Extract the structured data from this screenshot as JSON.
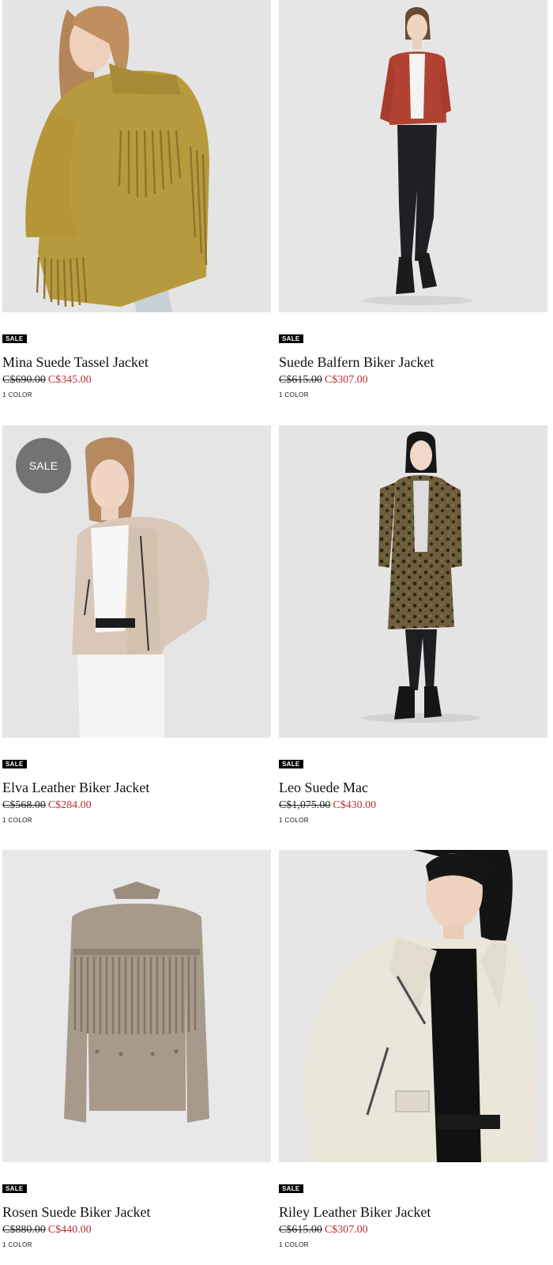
{
  "labels": {
    "sale_tag": "SALE",
    "sale_circle": "SALE"
  },
  "colors": {
    "sale_price": "#b4322c",
    "sale_tag_bg": "#000000",
    "sale_circle_bg": "#737373",
    "image_bg": "#e7e7e7"
  },
  "products": [
    {
      "name": "Mina Suede Tassel Jacket",
      "original_price": "C$690.00",
      "sale_price": "C$345.00",
      "colors": "1 COLOR",
      "image_subject": "model in mustard suede fringe jacket, rear view"
    },
    {
      "name": "Suede Balfern Biker Jacket",
      "original_price": "C$615.00",
      "sale_price": "C$307.00",
      "colors": "1 COLOR",
      "image_subject": "model in rust suede biker jacket, full length"
    },
    {
      "name": "Elva Leather Biker Jacket",
      "original_price": "C$568.00",
      "sale_price": "C$284.00",
      "colors": "1 COLOR",
      "image_subject": "model in cream leather biker jacket"
    },
    {
      "name": "Leo Suede Mac",
      "original_price": "C$1,075.00",
      "sale_price": "C$430.00",
      "colors": "1 COLOR",
      "image_subject": "model in leopard print suede coat, full length"
    },
    {
      "name": "Rosen Suede Biker Jacket",
      "original_price": "C$880.00",
      "sale_price": "C$440.00",
      "colors": "1 COLOR",
      "image_subject": "taupe suede fringe jacket, back view on plain background"
    },
    {
      "name": "Riley Leather Biker Jacket",
      "original_price": "C$615.00",
      "sale_price": "C$307.00",
      "colors": "1 COLOR",
      "image_subject": "model in off-white leather biker jacket, close crop"
    }
  ]
}
